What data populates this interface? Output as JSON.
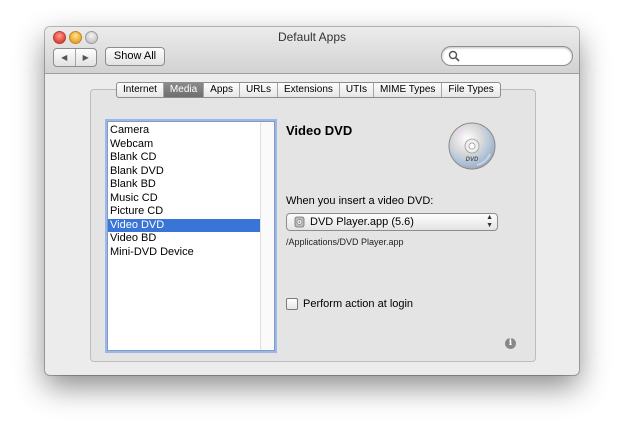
{
  "window": {
    "title": "Default Apps",
    "nav": {
      "back_glyph": "◀",
      "forward_glyph": "▶"
    },
    "show_all_label": "Show All",
    "search": {
      "placeholder": "",
      "icon": "search-icon"
    }
  },
  "tabs": [
    {
      "label": "Internet",
      "active": false
    },
    {
      "label": "Media",
      "active": true
    },
    {
      "label": "Apps",
      "active": false
    },
    {
      "label": "URLs",
      "active": false
    },
    {
      "label": "Extensions",
      "active": false
    },
    {
      "label": "UTIs",
      "active": false
    },
    {
      "label": "MIME Types",
      "active": false
    },
    {
      "label": "File Types",
      "active": false
    }
  ],
  "media_list": [
    {
      "label": "Camera",
      "selected": false
    },
    {
      "label": "Webcam",
      "selected": false
    },
    {
      "label": "Blank CD",
      "selected": false
    },
    {
      "label": "Blank DVD",
      "selected": false
    },
    {
      "label": "Blank BD",
      "selected": false
    },
    {
      "label": "Music CD",
      "selected": false
    },
    {
      "label": "Picture CD",
      "selected": false
    },
    {
      "label": "Video DVD",
      "selected": true
    },
    {
      "label": "Video BD",
      "selected": false
    },
    {
      "label": "Mini-DVD Device",
      "selected": false
    }
  ],
  "detail": {
    "title": "Video DVD",
    "icon": "dvd-disc-icon",
    "prompt": "When you insert a video DVD:",
    "app_select": {
      "value": "DVD Player.app (5.6)",
      "icon": "dvd-player-app-icon"
    },
    "path": "/Applications/DVD Player.app",
    "perform_at_login": {
      "label": "Perform action at login",
      "checked": false
    }
  },
  "info_glyph": "i",
  "colors": {
    "selection": "#3875d7",
    "active_tab": "#7a7a7a",
    "window_bg": "#ececec"
  }
}
